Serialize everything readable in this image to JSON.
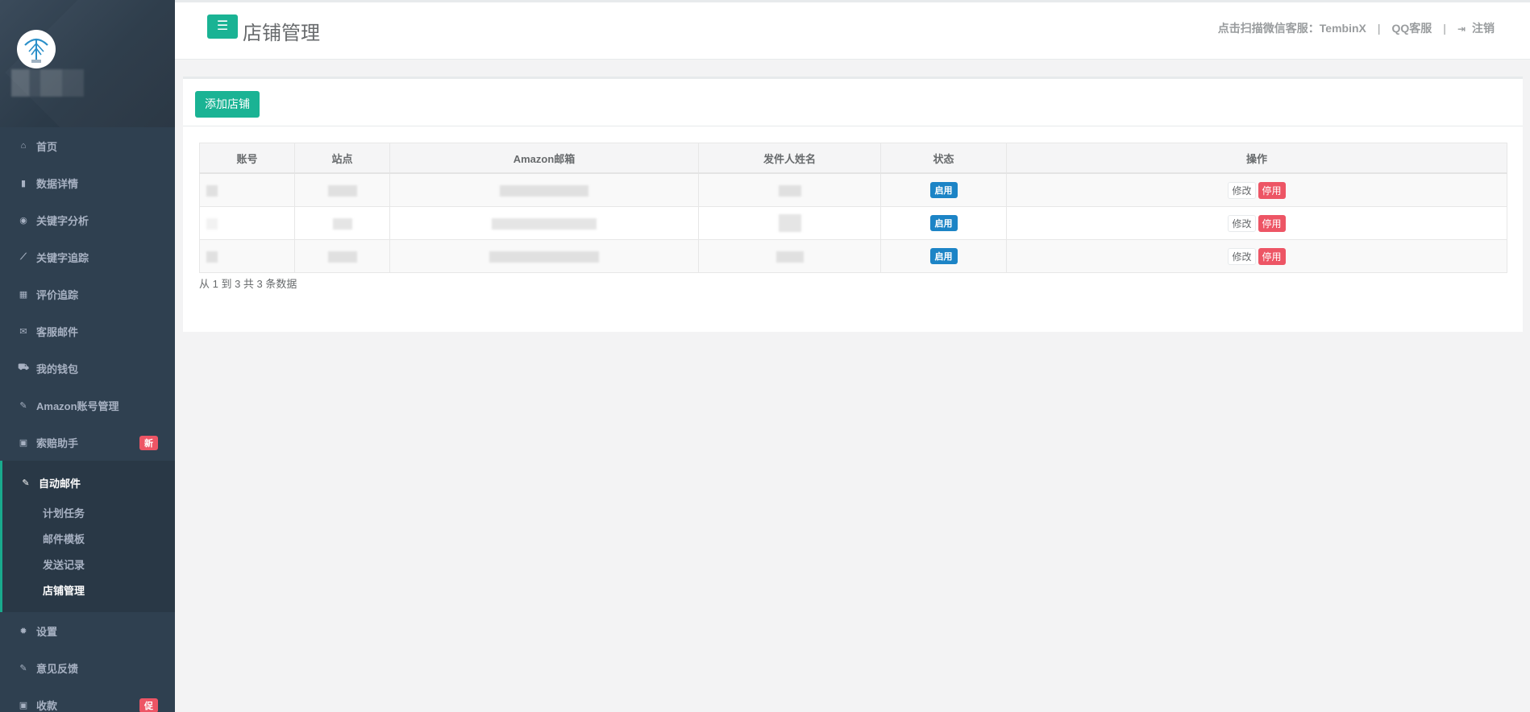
{
  "page": {
    "title": "店铺管理",
    "menu_icon": "bars-icon"
  },
  "topbar": {
    "wechat_label": "点击扫描微信客服：",
    "wechat_name": "TembinX",
    "separator": "|",
    "qq_label": "QQ客服",
    "logout_label": "注销",
    "logout_icon": "sign-out-icon"
  },
  "sidebar": {
    "items": [
      {
        "label": "首页",
        "icon": "home-icon"
      },
      {
        "label": "数据详情",
        "icon": "bar-chart-icon"
      },
      {
        "label": "关键字分析",
        "icon": "target-icon"
      },
      {
        "label": "关键字追踪",
        "icon": "line-chart-icon"
      },
      {
        "label": "评价追踪",
        "icon": "table-icon"
      },
      {
        "label": "客服邮件",
        "icon": "envelope-icon"
      },
      {
        "label": "我的钱包",
        "icon": "cart-icon"
      },
      {
        "label": "Amazon账号管理",
        "icon": "edit-icon"
      },
      {
        "label": "索赔助手",
        "icon": "money-icon",
        "badge": "新"
      },
      {
        "label": "设置",
        "icon": "gear-icon"
      },
      {
        "label": "意见反馈",
        "icon": "edit-icon"
      },
      {
        "label": "收款",
        "icon": "money-icon",
        "badge": "促"
      }
    ],
    "active_group": {
      "label": "自动邮件",
      "icon": "edit-icon",
      "subitems": [
        "计划任务",
        "邮件模板",
        "发送记录",
        "店铺管理"
      ],
      "current": "店铺管理"
    }
  },
  "toolbar": {
    "add_label": "添加店铺"
  },
  "table": {
    "headers": [
      "账号",
      "站点",
      "Amazon邮箱",
      "发件人姓名",
      "状态",
      "操作"
    ],
    "rows": [
      {
        "status": "启用",
        "edit": "修改",
        "disable": "停用"
      },
      {
        "status": "启用",
        "edit": "修改",
        "disable": "停用"
      },
      {
        "status": "启用",
        "edit": "修改",
        "disable": "停用"
      }
    ]
  },
  "pagination": {
    "info": "从 1 到 3 共 3 条数据"
  },
  "colors": {
    "sidebar_bg": "#2f4050",
    "accent_green": "#1ab394",
    "status_blue": "#1c84c6",
    "danger_red": "#ed5565"
  }
}
